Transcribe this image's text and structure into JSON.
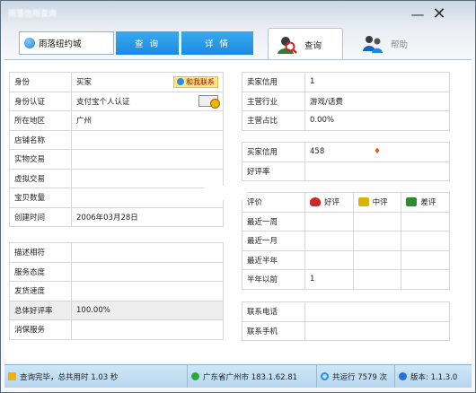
{
  "window": {
    "title": "雨落信用查询",
    "minimize_glyph": "—",
    "close_glyph": "✕"
  },
  "topbar": {
    "shop_name": "雨落纽约城",
    "query_button": "查 询",
    "detail_button": "详 情",
    "tabs": [
      {
        "label": "查询",
        "icon": "magnifier-person-icon",
        "active": true
      },
      {
        "label": "帮助",
        "icon": "people-help-icon",
        "active": false
      }
    ]
  },
  "basic": {
    "rows": [
      {
        "label": "身份",
        "value": "买家"
      },
      {
        "label": "身份认证",
        "value": "支付宝个人认证"
      },
      {
        "label": "所在地区",
        "value": "广州"
      },
      {
        "label": "店铺名称",
        "value": ""
      },
      {
        "label": "实物交易",
        "value": ""
      },
      {
        "label": "虚拟交易",
        "value": ""
      },
      {
        "label": "宝贝数量",
        "value": ""
      },
      {
        "label": "创建时间",
        "value": "2006年03月28日"
      }
    ],
    "chat_button": "和我联系"
  },
  "rating": {
    "rows": [
      {
        "label": "描述相符",
        "value": ""
      },
      {
        "label": "服务态度",
        "value": ""
      },
      {
        "label": "发货速度",
        "value": ""
      },
      {
        "label": "总体好评率",
        "value": "100.00%"
      },
      {
        "label": "消保服务",
        "value": ""
      }
    ]
  },
  "credit": {
    "rows": [
      {
        "label": "卖家信用",
        "value": "1"
      },
      {
        "label": "主营行业",
        "value": "游戏/话费"
      },
      {
        "label": "主营占比",
        "value": "0.00%"
      }
    ]
  },
  "buyer": {
    "rows": [
      {
        "label": "买家信用",
        "value": "458"
      },
      {
        "label": "好评率",
        "value": ""
      }
    ],
    "level_icon": "diamond-icon"
  },
  "evaluation": {
    "header": {
      "label": "评价",
      "good": "好评",
      "neutral": "中评",
      "bad": "差评"
    },
    "rows": [
      {
        "label": "最近一周",
        "good": "",
        "neutral": "",
        "bad": ""
      },
      {
        "label": "最近一月",
        "good": "",
        "neutral": "",
        "bad": ""
      },
      {
        "label": "最近半年",
        "good": "",
        "neutral": "",
        "bad": ""
      },
      {
        "label": "半年以前",
        "good": "1",
        "neutral": "",
        "bad": ""
      }
    ]
  },
  "contact": {
    "rows": [
      {
        "label": "联系电话",
        "value": ""
      },
      {
        "label": "联系手机",
        "value": ""
      }
    ]
  },
  "status": {
    "query": "查询完毕，总共用时 1.03 秒",
    "location": "广东省广州市 183.1.62.81",
    "runs": "共运行 7579 次",
    "version": "版本: 1.1.3.0"
  },
  "colors": {
    "accent": "#1b8be0",
    "status_bar": "#b6d6ef"
  }
}
